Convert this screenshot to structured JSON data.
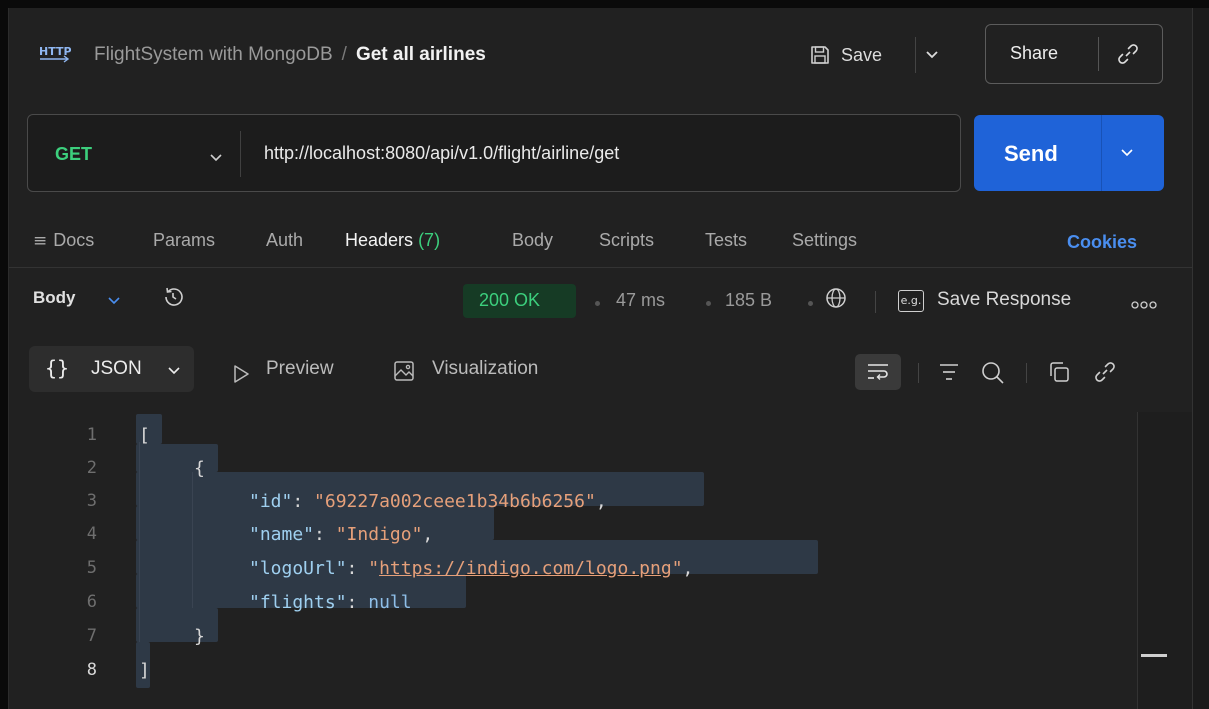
{
  "breadcrumb": {
    "protocol": "HTTP",
    "collection": "FlightSystem with MongoDB",
    "separator": "/",
    "request_name": "Get all airlines"
  },
  "toolbar": {
    "save_label": "Save",
    "share_label": "Share"
  },
  "request": {
    "method": "GET",
    "url": "http://localhost:8080/api/v1.0/flight/airline/get",
    "send_label": "Send"
  },
  "request_tabs": [
    {
      "label": "Docs"
    },
    {
      "label": "Params"
    },
    {
      "label": "Auth"
    },
    {
      "label": "Headers",
      "count": "(7)"
    },
    {
      "label": "Body"
    },
    {
      "label": "Scripts"
    },
    {
      "label": "Tests"
    },
    {
      "label": "Settings"
    }
  ],
  "cookies_label": "Cookies",
  "response": {
    "body_label": "Body",
    "status": "200 OK",
    "time": "47 ms",
    "size": "185 B",
    "eg_label": "e.g.",
    "save_response_label": "Save Response",
    "format_label": "JSON",
    "preview_label": "Preview",
    "visualization_label": "Visualization"
  },
  "code": {
    "line_numbers": [
      "1",
      "2",
      "3",
      "4",
      "5",
      "6",
      "7",
      "8"
    ],
    "open_bracket": "[",
    "close_bracket": "]",
    "open_brace": "{",
    "close_brace": "}",
    "fields": [
      {
        "key": "\"id\"",
        "value": "\"69227a002ceee1b34b6b6256\"",
        "trail": ","
      },
      {
        "key": "\"name\"",
        "value": "\"Indigo\"",
        "trail": ","
      },
      {
        "key": "\"logoUrl\"",
        "value_url": "https://indigo.com/logo.png",
        "trail": ","
      },
      {
        "key": "\"flights\"",
        "value_null": "null",
        "trail": ""
      }
    ]
  },
  "colors": {
    "accent_blue": "#1f63d8",
    "method_green": "#3ccf7d",
    "link_blue": "#4a8eef"
  }
}
